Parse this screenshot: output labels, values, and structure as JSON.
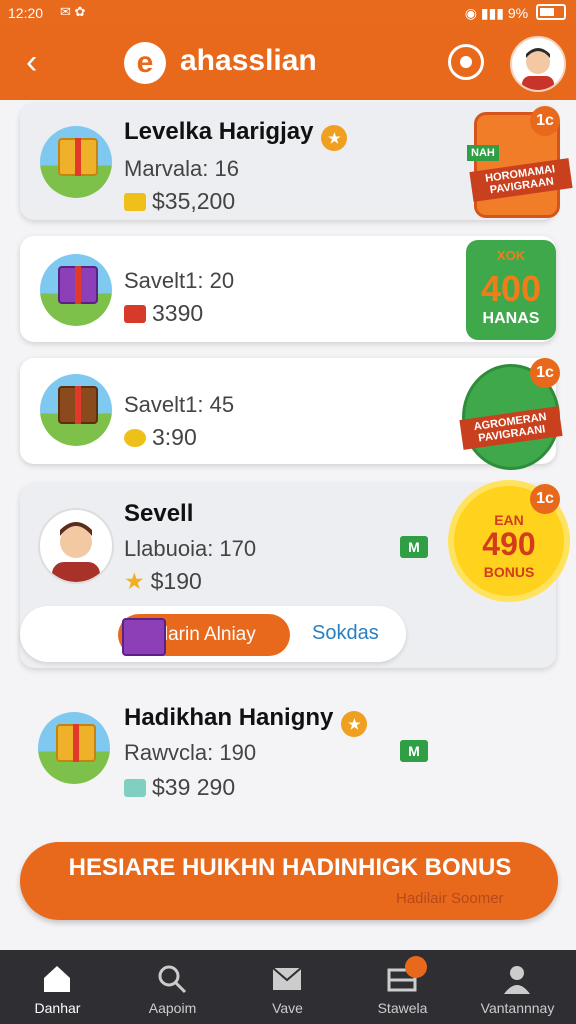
{
  "status_bar": {
    "time": "12:20",
    "battery": "9%"
  },
  "app_bar": {
    "title": "ahasslian",
    "logo_letter": "e"
  },
  "cards": [
    {
      "title": "Levelka Harigjay",
      "line": "Marvala: 16",
      "price": "$35,200",
      "promo_banner": "HOROMAMAI PAVIGRAAN",
      "promo_tag": "NAH",
      "corner": "1c"
    },
    {
      "line": "Savelt1: 20",
      "price": "3390",
      "promo_top": "XOK",
      "promo_big": "400",
      "promo_small": "HANAS"
    },
    {
      "line": "Savelt1: 45",
      "price": "3:90",
      "promo_banner": "AGROMERAN PAVIGRAANI",
      "corner": "1c"
    },
    {
      "title": "Sevell",
      "line": "Llabuoia: 170",
      "price": "$190",
      "check": "M",
      "corner": "1c"
    },
    {
      "title": "Hadikhan Hanigny",
      "line": "Rawvcla: 190",
      "price": "$39 290",
      "check": "M"
    }
  ],
  "starburst": {
    "line1": "EAN",
    "line2": "490",
    "line3": "BONUS"
  },
  "split_actions": {
    "primary": "Idarin Alniay",
    "secondary": "Sokdas"
  },
  "cta": {
    "label": "HESIARE HUIKHN HADINHIGK BONUS",
    "sub": "Hadilair Soomer"
  },
  "bottom_nav": [
    {
      "label": "Danhar",
      "icon": "home-icon"
    },
    {
      "label": "Aapoim",
      "icon": "search-icon"
    },
    {
      "label": "Vave",
      "icon": "mail-icon"
    },
    {
      "label": "Stawela",
      "icon": "inbox-icon"
    },
    {
      "label": "Vantannnay",
      "icon": "profile-icon"
    }
  ],
  "colors": {
    "accent": "#e8691c",
    "nav_bg": "#2f2f33",
    "card_bg": "#ffffff"
  }
}
